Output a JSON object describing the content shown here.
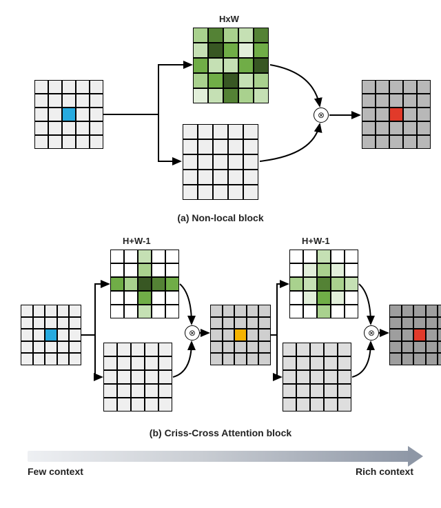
{
  "domain": "Diagram",
  "panel_a": {
    "caption": "(a) Non-local block",
    "top_label": "HxW",
    "input_highlight": {
      "row": 2,
      "col": 2,
      "color": "#27aadf"
    },
    "output_highlight": {
      "row": 2,
      "col": 2,
      "color": "#e13a2a"
    },
    "output_fill": "#b8b8b8",
    "attention_full": [
      [
        "#a9d18e",
        "#548235",
        "#a9d18e",
        "#c5e0b4",
        "#548235"
      ],
      [
        "#c5e0b4",
        "#385723",
        "#70ad47",
        "#e2efda",
        "#70ad47"
      ],
      [
        "#70ad47",
        "#c5e0b4",
        "#c5e0b4",
        "#70ad47",
        "#385723"
      ],
      [
        "#a9d18e",
        "#70ad47",
        "#385723",
        "#c5e0b4",
        "#a9d18e"
      ],
      [
        "#e2efda",
        "#c5e0b4",
        "#548235",
        "#a9d18e",
        "#c5e0b4"
      ]
    ]
  },
  "panel_b": {
    "caption": "(b) Criss-Cross Attention block",
    "stage1_label": "H+W-1",
    "stage2_label": "H+W-1",
    "input_highlight": {
      "row": 2,
      "col": 2,
      "color": "#27aadf"
    },
    "mid_highlight": {
      "row": 2,
      "col": 2,
      "color": "#f5b301"
    },
    "mid_fill": "#cfcfcf",
    "output_highlight": {
      "row": 2,
      "col": 2,
      "color": "#e13a2a"
    },
    "output_fill": "#9e9e9e",
    "cross1": {
      "row_vals": [
        "#70ad47",
        "#a9d18e",
        "#385723",
        "#548235",
        "#70ad47"
      ],
      "col_vals": [
        "#c5e0b4",
        "#a9d18e",
        "#385723",
        "#70ad47",
        "#c5e0b4"
      ]
    },
    "cross2": {
      "row_vals": [
        "#a9d18e",
        "#c5e0b4",
        "#548235",
        "#a9d18e",
        "#c5e0b4"
      ],
      "col_vals": [
        "#c5e0b4",
        "#a9d18e",
        "#548235",
        "#70ad47",
        "#a9d18e"
      ],
      "extra": [
        {
          "r": 1,
          "c": 1,
          "color": "#e2efda"
        },
        {
          "r": 1,
          "c": 3,
          "color": "#e2efda"
        },
        {
          "r": 3,
          "c": 1,
          "color": "#e2efda"
        },
        {
          "r": 3,
          "c": 3,
          "color": "#e2efda"
        }
      ]
    }
  },
  "legend": {
    "left": "Few context",
    "right": "Rich context"
  },
  "op_symbol": "⊗"
}
